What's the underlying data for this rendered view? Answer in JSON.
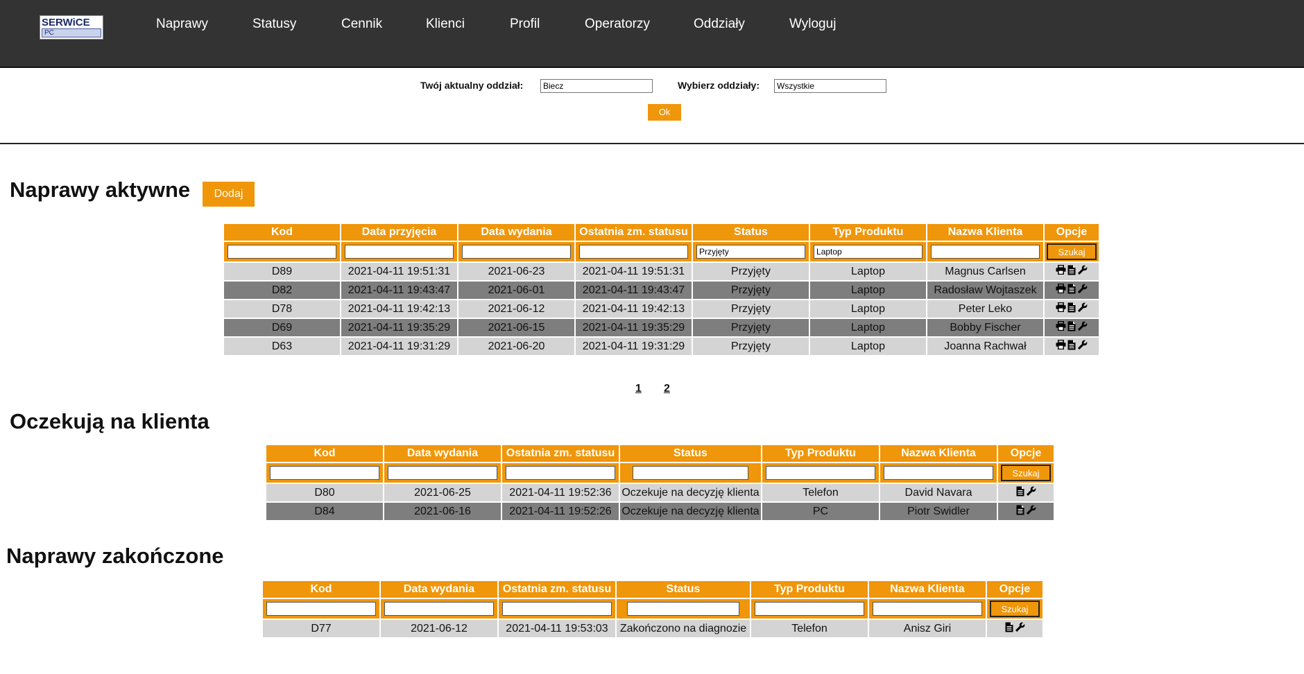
{
  "brand": {
    "line1": "SERWiCE",
    "line2": "PC"
  },
  "nav": [
    "Naprawy",
    "Statusy",
    "Cennik",
    "Klienci",
    "Profil",
    "Operatorzy",
    "Oddziały",
    "Wyloguj"
  ],
  "branch": {
    "current_label": "Twój aktualny oddział:",
    "current_value": "Biecz",
    "select_label": "Wybierz oddziały:",
    "select_value": "Wszystkie",
    "ok_label": "Ok"
  },
  "active": {
    "title": "Naprawy aktywne",
    "add_label": "Dodaj",
    "columns": [
      "Kod",
      "Data przyjęcia",
      "Data wydania",
      "Ostatnia zm. statusu",
      "Status",
      "Typ Produktu",
      "Nazwa Klienta",
      "Opcje"
    ],
    "filters": [
      "",
      "",
      "",
      "",
      "Przyjęty",
      "Laptop",
      ""
    ],
    "search_label": "Szukaj",
    "rows": [
      [
        "D89",
        "2021-04-11 19:51:31",
        "2021-06-23",
        "2021-04-11 19:51:31",
        "Przyjęty",
        "Laptop",
        "Magnus Carlsen"
      ],
      [
        "D82",
        "2021-04-11 19:43:47",
        "2021-06-01",
        "2021-04-11 19:43:47",
        "Przyjęty",
        "Laptop",
        "Radosław Wojtaszek"
      ],
      [
        "D78",
        "2021-04-11 19:42:13",
        "2021-06-12",
        "2021-04-11 19:42:13",
        "Przyjęty",
        "Laptop",
        "Peter Leko"
      ],
      [
        "D69",
        "2021-04-11 19:35:29",
        "2021-06-15",
        "2021-04-11 19:35:29",
        "Przyjęty",
        "Laptop",
        "Bobby Fischer"
      ],
      [
        "D63",
        "2021-04-11 19:31:29",
        "2021-06-20",
        "2021-04-11 19:31:29",
        "Przyjęty",
        "Laptop",
        "Joanna Rachwał"
      ]
    ],
    "options_icons": [
      "print-icon",
      "document-icon",
      "wrench-icon"
    ],
    "pages": [
      "1",
      "2"
    ]
  },
  "waiting": {
    "title": "Oczekują na klienta",
    "columns": [
      "Kod",
      "Data wydania",
      "Ostatnia zm. statusu",
      "Status",
      "Typ Produktu",
      "Nazwa Klienta",
      "Opcje"
    ],
    "search_label": "Szukaj",
    "rows": [
      [
        "D80",
        "2021-06-25",
        "2021-04-11 19:52:36",
        "Oczekuje na decyzję klienta",
        "Telefon",
        "David Navara"
      ],
      [
        "D84",
        "2021-06-16",
        "2021-04-11 19:52:26",
        "Oczekuje na decyzję klienta",
        "PC",
        "Piotr Swidler"
      ]
    ],
    "options_icons": [
      "document-icon",
      "wrench-icon"
    ]
  },
  "finished": {
    "title": "Naprawy zakończone",
    "columns": [
      "Kod",
      "Data wydania",
      "Ostatnia zm. statusu",
      "Status",
      "Typ Produktu",
      "Nazwa Klienta",
      "Opcje"
    ],
    "search_label": "Szukaj",
    "rows": [
      [
        "D77",
        "2021-06-12",
        "2021-04-11 19:53:03",
        "Zakończono na diagnozie",
        "Telefon",
        "Anisz Giri"
      ]
    ],
    "options_icons": [
      "document-icon",
      "wrench-icon"
    ]
  },
  "colors": {
    "accent": "#f0960a",
    "topbar": "#333333",
    "row_light": "#d4d4d4",
    "row_dark": "#7e7e7e"
  }
}
